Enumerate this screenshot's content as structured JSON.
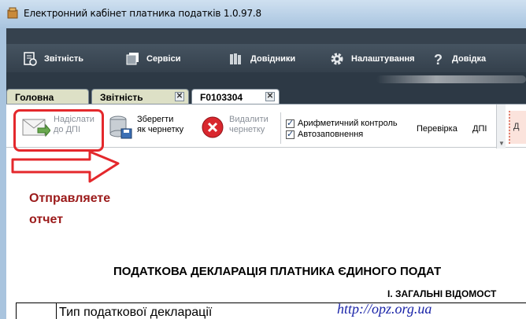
{
  "window": {
    "title": "Електронний кабінет платника податків 1.0.97.8"
  },
  "menu": {
    "items": [
      {
        "label": "Звітність",
        "icon": "report-icon"
      },
      {
        "label": "Сервіси",
        "icon": "services-icon"
      },
      {
        "label": "Довідники",
        "icon": "books-icon"
      },
      {
        "label": "Налаштування",
        "icon": "gear-icon"
      },
      {
        "label": "Довідка",
        "icon": "help-icon"
      }
    ]
  },
  "tabs": [
    {
      "label": "Головна",
      "closable": false
    },
    {
      "label": "Звітність",
      "closable": true
    },
    {
      "label": "F0103304",
      "closable": true,
      "active": true
    }
  ],
  "ribbon": {
    "send_line1": "Надіслати",
    "send_line2": "до ДПІ",
    "save_line1": "Зберегти",
    "save_line2": "як чернетку",
    "delete_line1": "Видалити",
    "delete_line2": "чернетку",
    "check_arith": "Арифметичний контроль",
    "check_autofill": "Автозаповнення",
    "verify": "Перевірка",
    "dpi": "ДПІ",
    "right_cut": "Д"
  },
  "annotation": {
    "line1": "Отправляете",
    "line2": "отчет",
    "color": "#e4282c"
  },
  "document": {
    "title": "ПОДАТКОВА ДЕКЛАРАЦІЯ ПЛАТНИКА ЄДИНОГО ПОДАТ",
    "section": "І. ЗАГАЛЬНІ ВІДОМОСТ",
    "row1": "Тип податкової декларації"
  },
  "watermark": "http://opz.org.ua"
}
